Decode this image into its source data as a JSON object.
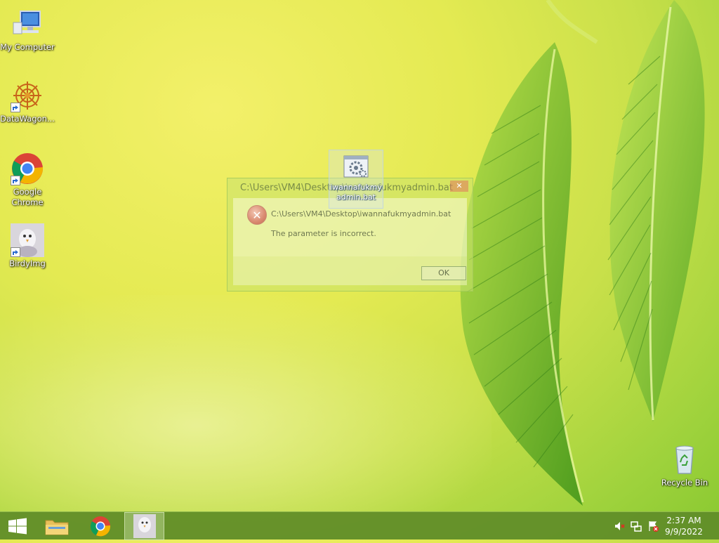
{
  "desktop": {
    "icons": [
      {
        "label": "My Computer"
      },
      {
        "label": "DataWagon..."
      },
      {
        "label": "Google Chrome"
      },
      {
        "label": "BirdyImg"
      },
      {
        "label": "Recycle Bin"
      }
    ],
    "dragged_file": {
      "label": "iwannafukmyadmin.bat"
    }
  },
  "dialog": {
    "title": "C:\\Users\\VM4\\Desktop\\iwannafukmyadmin.bat",
    "close_glyph": "✕",
    "path": "C:\\Users\\VM4\\Desktop\\iwannafukmyadmin.bat",
    "message": "The parameter is incorrect.",
    "ok_label": "OK",
    "icon": "error-icon"
  },
  "taskbar": {
    "start_icon": "windows-logo-icon",
    "pinned": [
      "file-explorer-icon",
      "chrome-icon",
      "birdyimg-icon"
    ],
    "tray": [
      "volume-muted-icon",
      "network-icon",
      "action-center-icon"
    ],
    "time": "2:37 AM",
    "date": "9/9/2022"
  },
  "colors": {
    "taskbar": "#608c28",
    "error_red": "#c56a52"
  }
}
